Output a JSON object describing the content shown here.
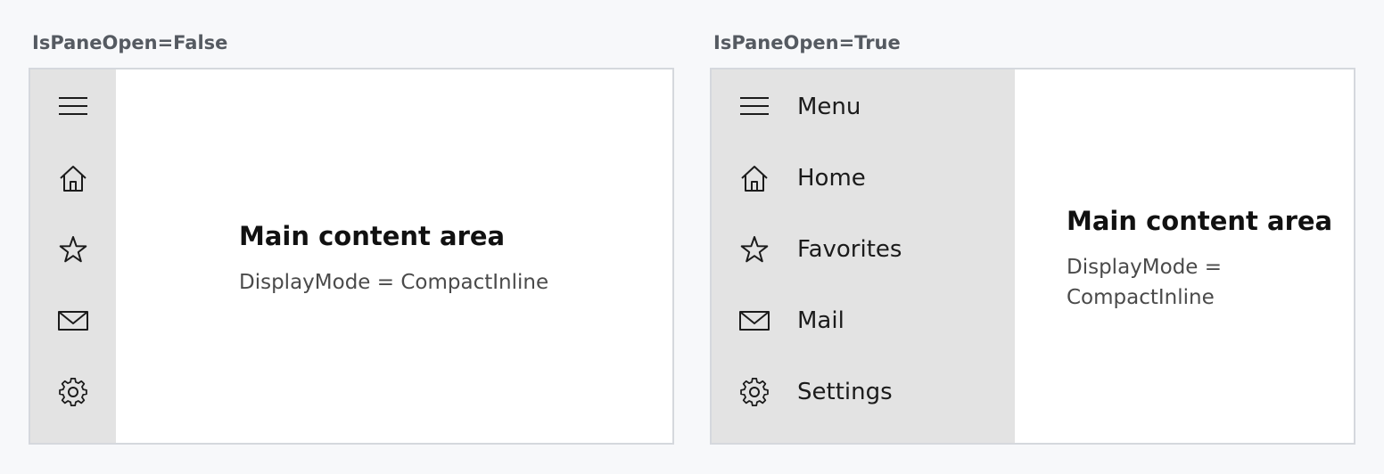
{
  "panels": [
    {
      "caption": "IsPaneOpen=False",
      "content": {
        "title": "Main content area",
        "subtitle": "DisplayMode = CompactInline"
      }
    },
    {
      "caption": "IsPaneOpen=True",
      "content": {
        "title": "Main content area",
        "subtitle_line1": "DisplayMode =",
        "subtitle_line2": "CompactInline"
      }
    }
  ],
  "nav": {
    "items": [
      {
        "label": "Menu",
        "icon": "hamburger-icon"
      },
      {
        "label": "Home",
        "icon": "home-icon"
      },
      {
        "label": "Favorites",
        "icon": "star-icon"
      },
      {
        "label": "Mail",
        "icon": "mail-icon"
      },
      {
        "label": "Settings",
        "icon": "gear-icon"
      }
    ]
  },
  "colors": {
    "background": "#f7f8fa",
    "pane": "#e3e3e3",
    "frame_border": "#d5d8dd",
    "content": "#ffffff",
    "caption": "#555a61"
  }
}
